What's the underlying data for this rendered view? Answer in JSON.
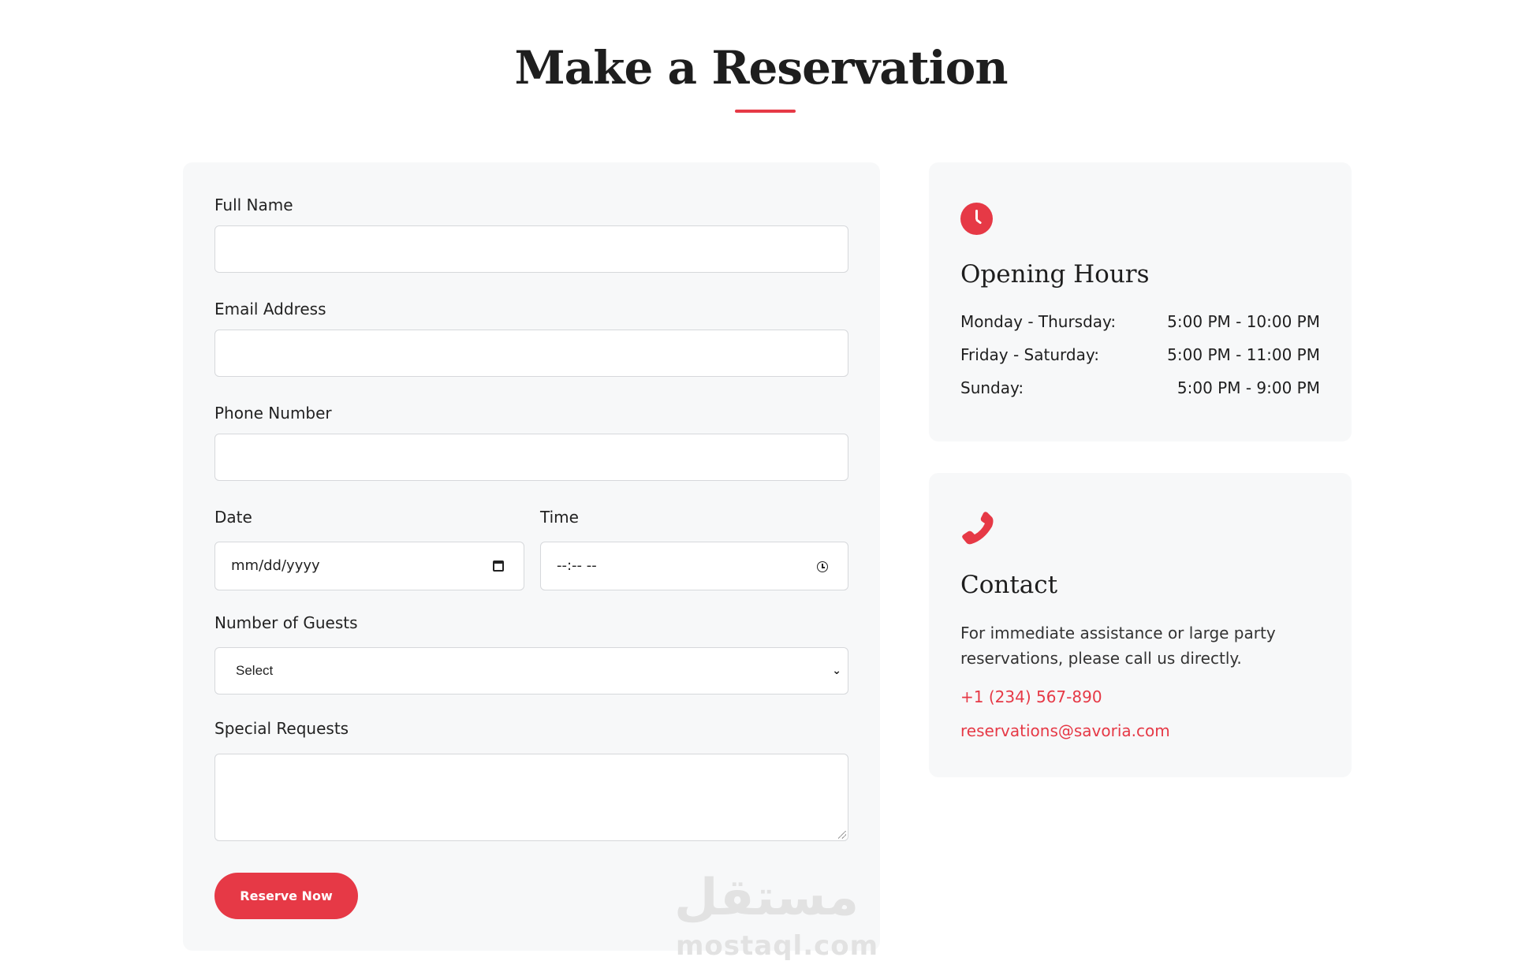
{
  "header": {
    "title": "Make a Reservation",
    "accent_color": "#e63946"
  },
  "form": {
    "full_name": {
      "label": "Full Name",
      "value": ""
    },
    "email": {
      "label": "Email Address",
      "value": ""
    },
    "phone": {
      "label": "Phone Number",
      "value": ""
    },
    "date": {
      "label": "Date",
      "placeholder": "mm/dd/yyyy",
      "icon": "calendar-icon"
    },
    "time": {
      "label": "Time",
      "placeholder": "--:-- --",
      "icon": "clock-icon"
    },
    "guests": {
      "label": "Number of Guests",
      "selected": "Select"
    },
    "requests": {
      "label": "Special Requests",
      "value": ""
    },
    "submit_label": "Reserve Now"
  },
  "hours": {
    "icon": "clock-icon",
    "title": "Opening Hours",
    "rows": [
      {
        "day": "Monday - Thursday:",
        "time": "5:00 PM - 10:00 PM"
      },
      {
        "day": "Friday - Saturday:",
        "time": "5:00 PM - 11:00 PM"
      },
      {
        "day": "Sunday:",
        "time": "5:00 PM - 9:00 PM"
      }
    ]
  },
  "contact": {
    "icon": "phone-icon",
    "title": "Contact",
    "text": "For immediate assistance or large party reservations, please call us directly.",
    "phone": "+1 (234) 567-890",
    "email": "reservations@savoria.com"
  },
  "watermark": {
    "arabic": "مستقل",
    "latin": "mostaql.com"
  }
}
